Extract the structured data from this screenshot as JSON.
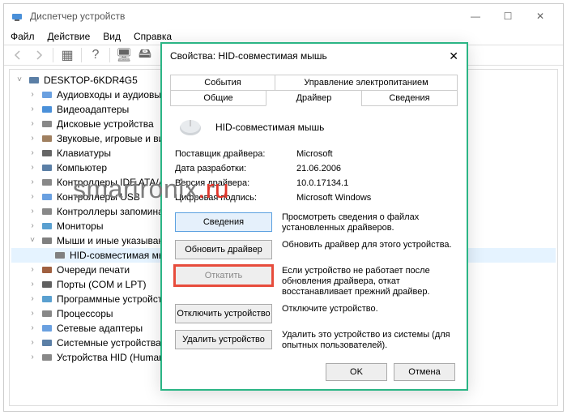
{
  "main": {
    "title": "Диспетчер устройств",
    "menu": {
      "file": "Файл",
      "action": "Действие",
      "view": "Вид",
      "help": "Справка"
    }
  },
  "tree": {
    "root": "DESKTOP-6KDR4G5",
    "items": [
      "Аудиовходы и аудиовыходы",
      "Видеоадаптеры",
      "Дисковые устройства",
      "Звуковые, игровые и видеоустройства",
      "Клавиатуры",
      "Компьютер",
      "Контроллеры IDE ATA/ATAPI",
      "Контроллеры USB",
      "Контроллеры запоминающих устройств",
      "Мониторы"
    ],
    "mice_node": "Мыши и иные указывающие устройства",
    "mice_child": "HID-совместимая мышь",
    "items_after": [
      "Очереди печати",
      "Порты (COM и LPT)",
      "Программные устройства",
      "Процессоры",
      "Сетевые адаптеры",
      "Системные устройства",
      "Устройства HID (Human Interface Devices)"
    ]
  },
  "dialog": {
    "title": "Свойства: HID-совместимая мышь",
    "tabs": {
      "events": "События",
      "power": "Управление электропитанием",
      "general": "Общие",
      "driver": "Драйвер",
      "details": "Сведения"
    },
    "device_name": "HID-совместимая мышь",
    "info": {
      "provider_label": "Поставщик драйвера:",
      "provider_value": "Microsoft",
      "date_label": "Дата разработки:",
      "date_value": "21.06.2006",
      "version_label": "Версия драйвера:",
      "version_value": "10.0.17134.1",
      "sig_label": "Цифровая подпись:",
      "sig_value": "Microsoft Windows"
    },
    "buttons": {
      "details": "Сведения",
      "details_desc": "Просмотреть сведения о файлах установленных драйверов.",
      "update": "Обновить драйвер",
      "update_desc": "Обновить драйвер для этого устройства.",
      "rollback": "Откатить",
      "rollback_desc": "Если устройство не работает после обновления драйвера, откат восстанавливает прежний драйвер.",
      "disable": "Отключить устройство",
      "disable_desc": "Отключите устройство.",
      "uninstall": "Удалить устройство",
      "uninstall_desc": "Удалить это устройство из системы (для опытных пользователей)."
    },
    "footer": {
      "ok": "OK",
      "cancel": "Отмена"
    }
  },
  "watermark": {
    "part1": "smartronix",
    "part2": ".ru"
  }
}
